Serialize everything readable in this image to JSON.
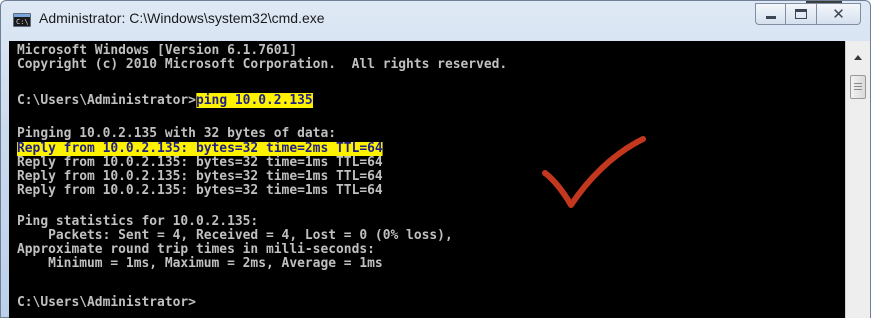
{
  "window": {
    "title": "Administrator: C:\\Windows\\system32\\cmd.exe",
    "icon": "cmd-icon",
    "icon_text": "C:\\",
    "controls": {
      "minimize": "minimize-icon",
      "maximize": "maximize-icon",
      "close": "close-icon",
      "close_glyph": "✕"
    }
  },
  "colors": {
    "highlight": "#fff200",
    "checkmark": "#c4371f",
    "console_bg": "#000000",
    "console_text": "#c0c0c0"
  },
  "console": {
    "lines": [
      {
        "text": "Microsoft Windows [Version 6.1.7601]"
      },
      {
        "text": "Copyright (c) 2010 Microsoft Corporation.  All rights reserved."
      },
      {
        "text": ""
      },
      {
        "prompt": "C:\\Users\\Administrator>",
        "command": "ping 10.0.2.135"
      },
      {
        "text": ""
      },
      {
        "text": "Pinging 10.0.2.135 with 32 bytes of data:"
      },
      {
        "text": "Reply from 10.0.2.135: bytes=32 time=2ms TTL=64",
        "highlighted": true
      },
      {
        "text": "Reply from 10.0.2.135: bytes=32 time=1ms TTL=64"
      },
      {
        "text": "Reply from 10.0.2.135: bytes=32 time=1ms TTL=64"
      },
      {
        "text": "Reply from 10.0.2.135: bytes=32 time=1ms TTL=64"
      },
      {
        "text": ""
      },
      {
        "text": "Ping statistics for 10.0.2.135:"
      },
      {
        "text": "    Packets: Sent = 4, Received = 4, Lost = 0 (0% loss),"
      },
      {
        "text": "Approximate round trip times in milli-seconds:"
      },
      {
        "text": "    Minimum = 1ms, Maximum = 2ms, Average = 1ms"
      },
      {
        "text": ""
      },
      {
        "prompt": "C:\\Users\\Administrator>",
        "command": ""
      }
    ]
  },
  "annotation": {
    "icon": "checkmark-icon"
  }
}
